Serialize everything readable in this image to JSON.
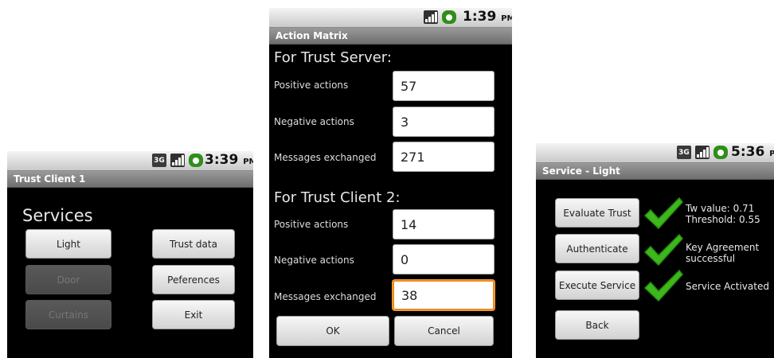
{
  "screen1": {
    "status": {
      "icons": [
        "3g-icon",
        "signal-icon",
        "battery-icon"
      ],
      "net_text": "3G",
      "time": "3:39",
      "ampm": "PM"
    },
    "title": "Trust Client 1",
    "heading": "Services",
    "buttons": {
      "light": "Light",
      "door": "Door",
      "curtains": "Curtains",
      "trust_data": "Trust data",
      "preferences": "Peferences",
      "exit": "Exit"
    }
  },
  "screen2": {
    "status": {
      "icons": [
        "no-sim-signal-icon",
        "battery-icon"
      ],
      "time": "1:39",
      "ampm": "PM"
    },
    "title": "Action Matrix",
    "server": {
      "heading": "For Trust Server:",
      "rows": [
        {
          "label": "Positive actions",
          "value": "57"
        },
        {
          "label": "Negative actions",
          "value": "3"
        },
        {
          "label": "Messages exchanged",
          "value": "271"
        }
      ]
    },
    "client": {
      "heading": "For Trust Client 2:",
      "rows": [
        {
          "label": "Positive actions",
          "value": "14"
        },
        {
          "label": "Negative actions",
          "value": "0"
        },
        {
          "label": "Messages exchanged",
          "value": "38"
        }
      ]
    },
    "ok": "OK",
    "cancel": "Cancel"
  },
  "screen3": {
    "status": {
      "icons": [
        "3g-icon",
        "signal-icon",
        "battery-icon"
      ],
      "net_text": "3G",
      "time": "5:36",
      "ampm": "PM"
    },
    "title": "Service - Light",
    "evaluate": "Evaluate Trust",
    "authenticate": "Authenticate",
    "execute": "Execute Service",
    "back": "Back",
    "results": {
      "trust": "Tw value: 0.71\nThreshold: 0.55",
      "auth": "Key Agreement\nsuccessful",
      "service": "Service Activated"
    }
  },
  "colors": {
    "check_green": "#3cb81c",
    "focus_orange": "#f08a18"
  }
}
